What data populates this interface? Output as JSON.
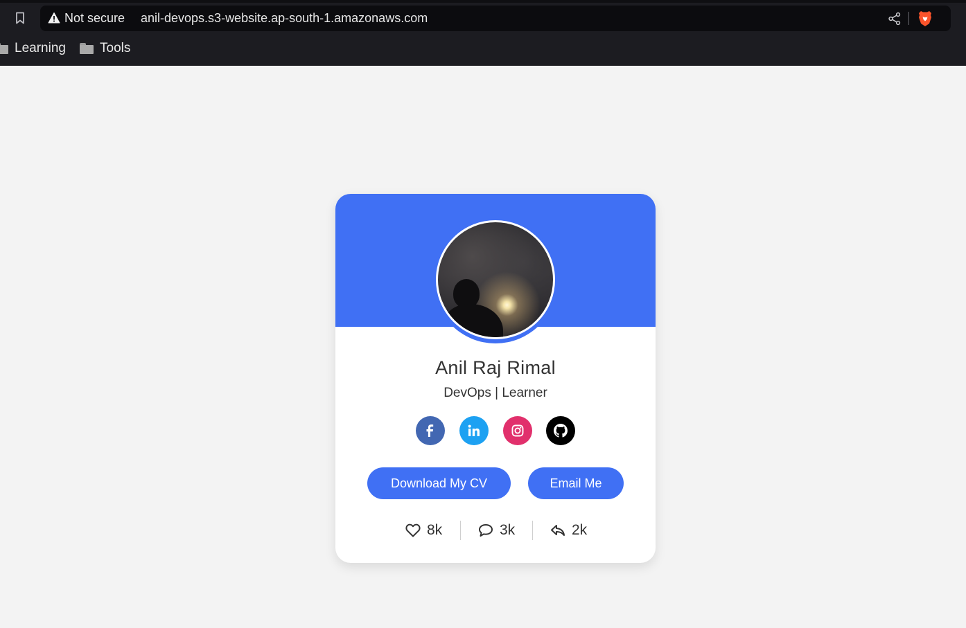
{
  "browser": {
    "security_label": "Not secure",
    "url": "anil-devops.s3-website.ap-south-1.amazonaws.com",
    "bookmarks": [
      {
        "label": "Learning"
      },
      {
        "label": "Tools"
      }
    ]
  },
  "profile": {
    "name": "Anil Raj Rimal",
    "role": "DevOps | Learner",
    "social": [
      {
        "icon": "facebook-icon",
        "color": "#4267b2"
      },
      {
        "icon": "linkedin-icon",
        "color": "#1da1f2"
      },
      {
        "icon": "instagram-icon",
        "color": "#e1306c"
      },
      {
        "icon": "github-icon",
        "color": "#000000"
      }
    ],
    "buttons": {
      "download_cv": "Download My CV",
      "email_me": "Email Me"
    },
    "stats": {
      "likes": "8k",
      "comments": "3k",
      "shares": "2k"
    }
  },
  "colors": {
    "accent": "#4070f4",
    "page_background": "#f3f3f3",
    "card_background": "#ffffff",
    "chrome_background": "#1c1c21"
  }
}
